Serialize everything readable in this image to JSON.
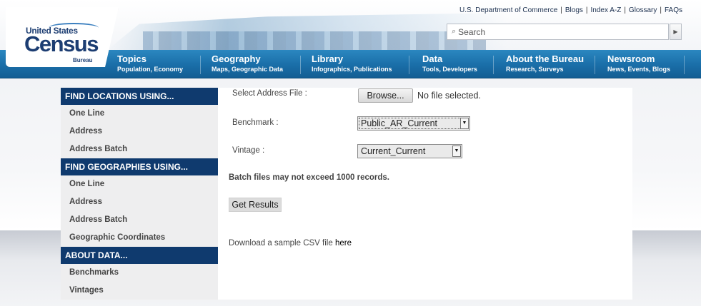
{
  "header": {
    "utility_links": [
      "U.S. Department of Commerce",
      "Blogs",
      "Index A-Z",
      "Glossary",
      "FAQs"
    ],
    "search": {
      "placeholder": "Search",
      "icon": "search-icon"
    },
    "logo": {
      "line1": "United States",
      "line2": "Census",
      "line3": "Bureau"
    }
  },
  "nav": [
    {
      "title": "Topics",
      "sub": "Population, Economy"
    },
    {
      "title": "Geography",
      "sub": "Maps, Geographic Data"
    },
    {
      "title": "Library",
      "sub": "Infographics, Publications"
    },
    {
      "title": "Data",
      "sub": "Tools, Developers"
    },
    {
      "title": "About the Bureau",
      "sub": "Research, Surveys"
    },
    {
      "title": "Newsroom",
      "sub": "News, Events, Blogs"
    }
  ],
  "sidebar": {
    "sections": [
      {
        "heading": "FIND LOCATIONS USING...",
        "items": [
          "One Line",
          "Address",
          "Address Batch"
        ]
      },
      {
        "heading": "FIND GEOGRAPHIES USING...",
        "items": [
          "One Line",
          "Address",
          "Address Batch",
          "Geographic Coordinates"
        ]
      },
      {
        "heading": "ABOUT DATA...",
        "items": [
          "Benchmarks",
          "Vintages"
        ]
      }
    ]
  },
  "form": {
    "file_label": "Select Address File :",
    "browse_label": "Browse...",
    "file_status": "No file selected.",
    "benchmark_label": "Benchmark :",
    "benchmark_value": "Public_AR_Current",
    "vintage_label": "Vintage :",
    "vintage_value": "Current_Current",
    "batch_note": "Batch files may not exceed 1000 records.",
    "submit_label": "Get Results",
    "sample_text": "Download a sample CSV file",
    "sample_link": "here"
  },
  "colors": {
    "nav_blue": "#1a6ea8",
    "sidebar_heading": "#0f3a6e",
    "logo_blue": "#1c3d72"
  }
}
